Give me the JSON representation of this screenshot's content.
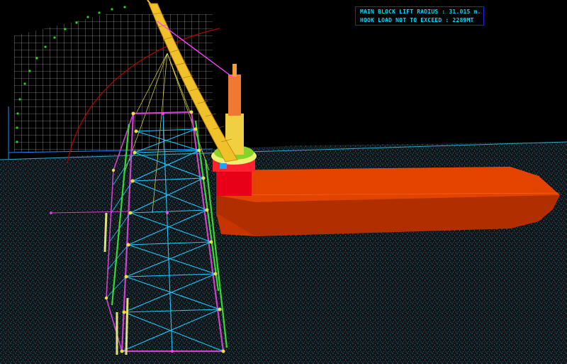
{
  "info": {
    "lift_radius_label": "MAIN BLOCK LIFT RADIUS : 31.015 m.",
    "hook_load_label": "HOOK LOAD NOT TO EXCEED : 2289MT"
  },
  "colors": {
    "background": "#000000",
    "sea": "#1a1a1a",
    "sea_dots": "#21a9c8",
    "barge": "#d63c00",
    "crane_boom": "#f0c22a",
    "jacket_primary": "#d040d0",
    "jacket_bracing": "#1ec8ff",
    "jacket_legs_green": "#35d930",
    "grid": "#e8e8e8",
    "radius_arc": "#b00000",
    "info_border": "#2222ee",
    "info_text": "#00d8ff"
  }
}
